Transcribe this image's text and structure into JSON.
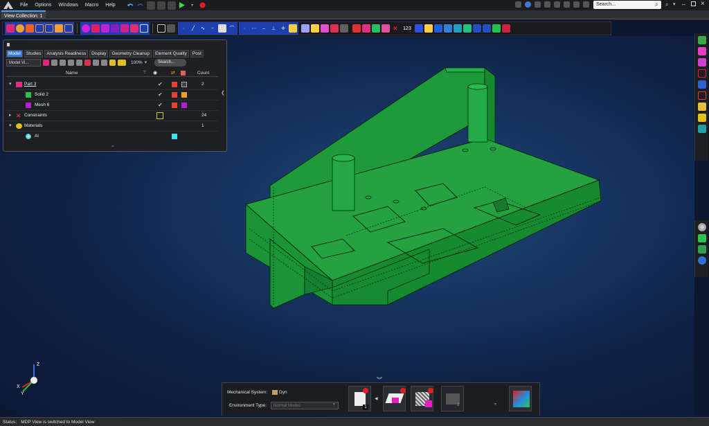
{
  "menubar": {
    "items": [
      "File",
      "Options",
      "Windows",
      "Macro",
      "Help"
    ],
    "search_placeholder": "Search..."
  },
  "view_collection": {
    "tab_label": "View Collection: 1"
  },
  "toolbar": {
    "numeric_label": "123"
  },
  "panel": {
    "tabs": [
      "Model",
      "Studies",
      "Analysis Readiness",
      "Display",
      "Geometry Cleanup",
      "Element Quality",
      "Post"
    ],
    "active_tab": "Model",
    "view_selector": "Model Vi...",
    "zoom": "100%",
    "search_placeholder": "Search...",
    "columns": {
      "name": "Name",
      "count": "Count"
    },
    "rows": [
      {
        "label": "Part 3",
        "count": "2",
        "level": 0
      },
      {
        "label": "Solid 2",
        "count": "",
        "level": 1
      },
      {
        "label": "Mesh 6",
        "count": "",
        "level": 1
      },
      {
        "label": "Constraints",
        "count": "24",
        "level": 0
      },
      {
        "label": "Materials",
        "count": "1",
        "level": 0
      },
      {
        "label": "Al",
        "count": "",
        "level": 1
      }
    ]
  },
  "dock": {
    "mechanical_system_label": "Mechanical System:",
    "mechanical_system_value": "Dyn",
    "environment_type_label": "Environment Type:",
    "environment_type_value": "Normal Modes",
    "badge1": "1",
    "badge2": "2"
  },
  "status": {
    "label": "Status:",
    "message": "MDP View is switched to Model View"
  },
  "triad": {
    "x": "X",
    "y": "Y",
    "z": "Z"
  },
  "colors": {
    "model_green": "#1e9a3a",
    "tab_blue": "#3b78d8",
    "constraint_yellow": "#e0c020",
    "material_cyan": "#3de0f0",
    "mesh_purple": "#b020d0",
    "red_square": "#e84030"
  }
}
